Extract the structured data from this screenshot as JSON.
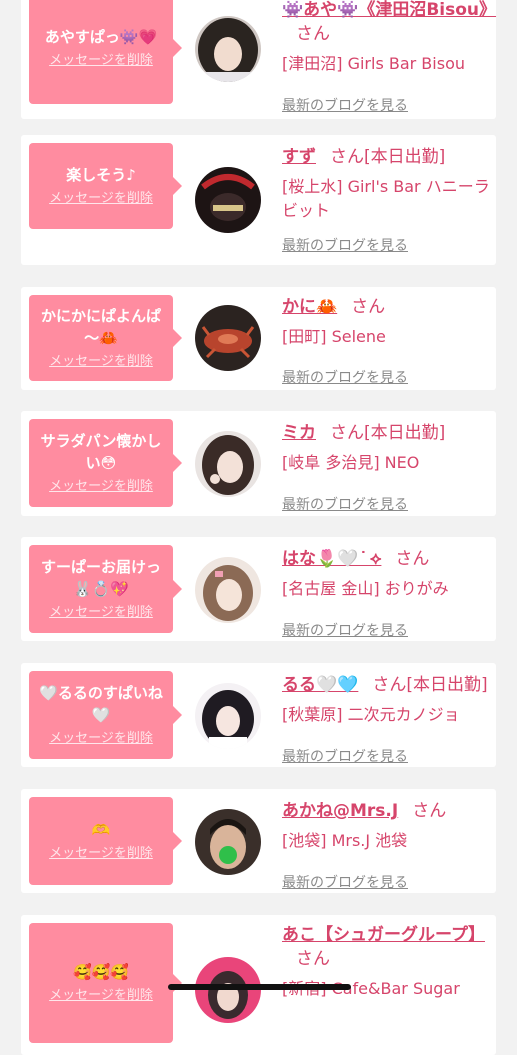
{
  "delete_label": "メッセージを削除",
  "blog_label": "最新のブログを見る",
  "san_label": "さん",
  "cards": [
    {
      "message": "あやすぱっ👾💗",
      "name": "👾あや👾《津田沼Bisou》",
      "san": "さん",
      "badge": "",
      "shop": "[津田沼] Girls Bar Bisou"
    },
    {
      "message": "楽しそう♪",
      "name": "すず",
      "san": "さん",
      "badge": "[本日出勤]",
      "shop": "[桜上水] Girl's Bar ハニーラビット"
    },
    {
      "message": "かにかにぱよんぱ～🦀",
      "name": "かに🦀",
      "san": "さん",
      "badge": "",
      "shop": "[田町] Selene"
    },
    {
      "message": "サラダパン懐かしい😳",
      "name": "ミカ",
      "san": "さん",
      "badge": "[本日出勤]",
      "shop": "[岐阜 多治見] NEO"
    },
    {
      "message": "すーぱーお届けっ🐰💍💖",
      "name": "はな🌷🤍 ͘ ⟡",
      "san": "さん",
      "badge": "",
      "shop": "[名古屋 金山] おりがみ"
    },
    {
      "message": "🤍るるのすぱいね🤍",
      "name": "るる🤍🩵",
      "san": "さん",
      "badge": "[本日出勤]",
      "shop": "[秋葉原] 二次元カノジョ"
    },
    {
      "message": "🫶",
      "name": "あかね@Mrs.J",
      "san": "さん",
      "badge": "",
      "shop": "[池袋] Mrs.J 池袋"
    },
    {
      "message": "🥰🥰🥰",
      "name": "あこ【シュガーグループ】",
      "san": "さん",
      "badge": "",
      "shop": "[新宿] Cafe&Bar Sugar"
    }
  ]
}
